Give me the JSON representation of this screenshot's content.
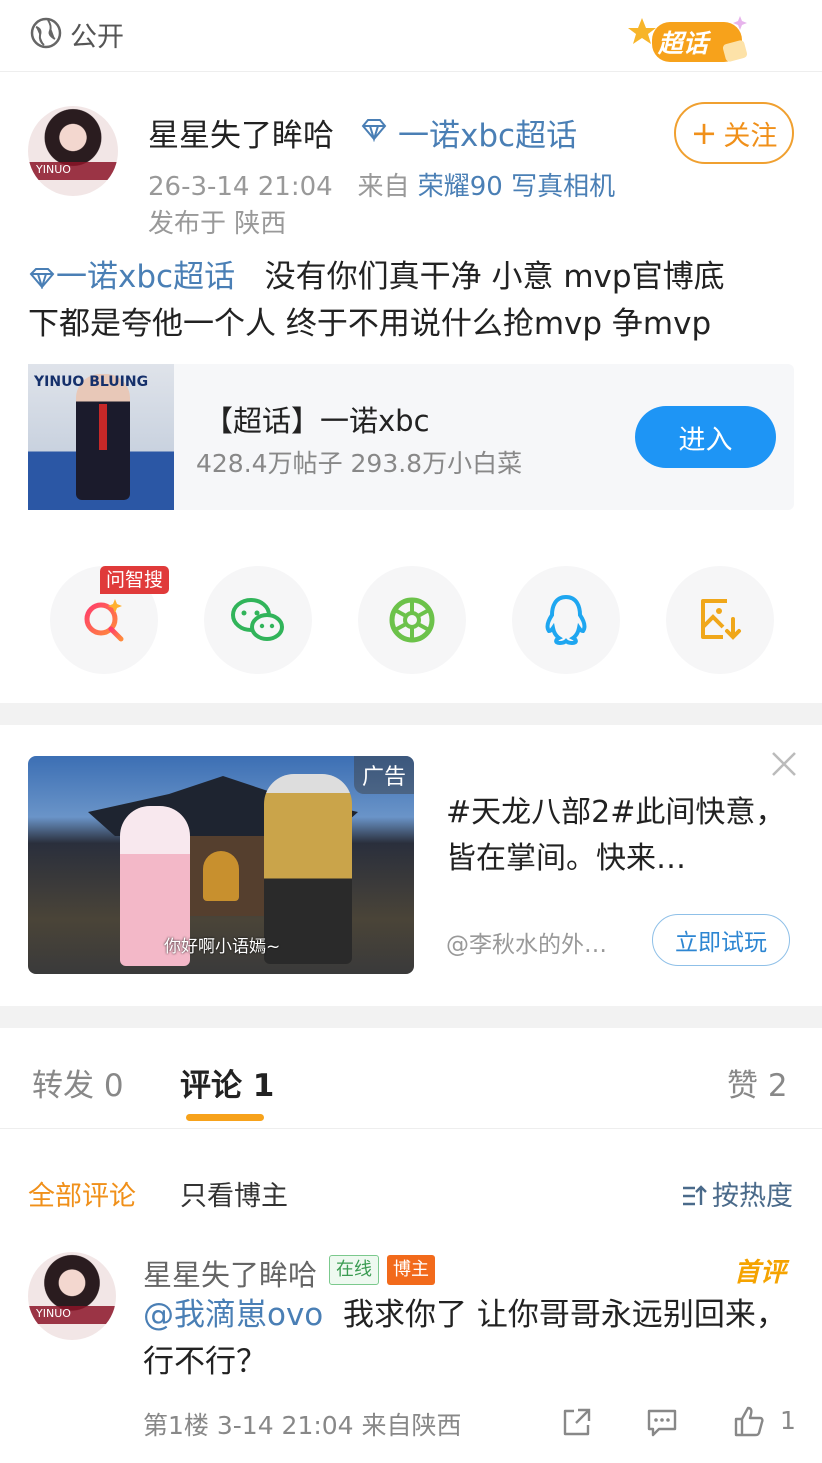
{
  "header": {
    "visibility_label": "公开",
    "chaohua_badge_label": "超话"
  },
  "post": {
    "author": "星星失了眸哈",
    "chaohua_link": "一诺xbc超话",
    "timestamp": "26-3-14 21:04",
    "source_prefix": "来自",
    "device": "荣耀90 写真相机",
    "location": "发布于 陕西",
    "follow_label": "关注",
    "body_tag": "一诺xbc超话",
    "body_line1": "没有你们真干净 小意 mvp官博底",
    "body_line2": "下都是夸他一个人 终于不用说什么抢mvp 争mvp"
  },
  "card": {
    "title": "【超话】一诺xbc",
    "stats": "428.4万帖子 293.8万小白菜",
    "enter_label": "进入",
    "cover_letters": "YINUO BLUING"
  },
  "share": {
    "ask_tag": "问智搜"
  },
  "ad": {
    "tag": "广告",
    "subtitle": "你好啊小语嫣~",
    "title": "#天龙八部2#此间快意，皆在掌间。快来…",
    "source": "@李秋水的外…",
    "action_label": "立即试玩"
  },
  "tabs": [
    {
      "label": "转发",
      "count": "0"
    },
    {
      "label": "评论",
      "count": "1"
    },
    {
      "label": "赞",
      "count": "2"
    }
  ],
  "filters": {
    "all": "全部评论",
    "owner_only": "只看博主",
    "sort": "按热度"
  },
  "comment": {
    "author": "星星失了眸哈",
    "online_badge": "在线",
    "owner_badge": "博主",
    "first_label": "首评",
    "mention": "@我滴崽ovo",
    "text": "我求你了 让你哥哥永远别回来，行不行？",
    "floor": "第1楼",
    "time": "3-14 21:04",
    "from": "来自陕西",
    "like_count": "1"
  },
  "colors": {
    "accent_orange": "#f0901a",
    "link_blue": "#4a7fb5",
    "enter_blue": "#1e95f5"
  }
}
